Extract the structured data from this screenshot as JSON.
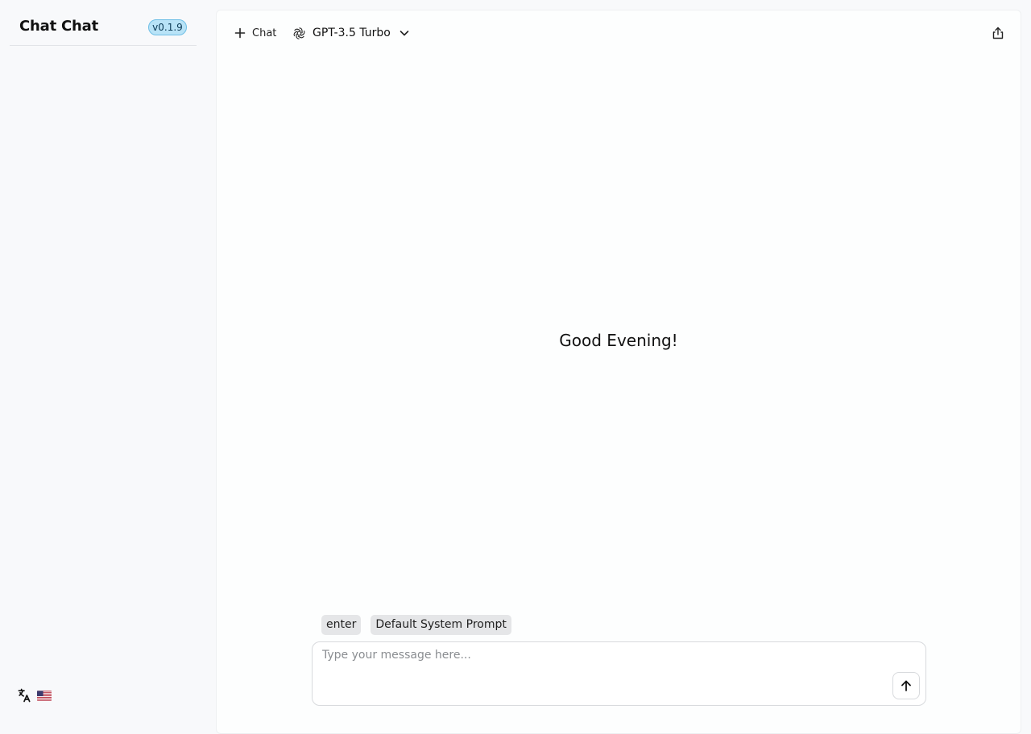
{
  "app": {
    "title": "Chat Chat",
    "version": "v0.1.9"
  },
  "sidebar": {
    "language_icon": "translate-icon",
    "language_flag": "us-flag"
  },
  "topbar": {
    "new_chat_label": "Chat",
    "model_label": "GPT-3.5 Turbo",
    "share_icon": "share-icon"
  },
  "main": {
    "greeting": "Good Evening!"
  },
  "prompt_chips": [
    {
      "label": "enter"
    },
    {
      "label": "Default System Prompt"
    }
  ],
  "composer": {
    "placeholder": "Type your message here...",
    "value": "",
    "send_icon": "arrow-up-icon"
  },
  "colors": {
    "version_badge_bg": "#b8e3f7",
    "version_badge_border": "#6fbfe6",
    "sidebar_bg": "#f8f9fb",
    "chip_bg": "#e5e6e8"
  }
}
